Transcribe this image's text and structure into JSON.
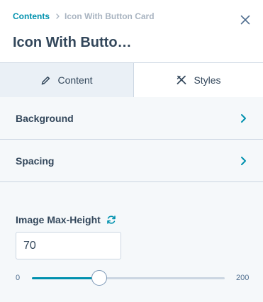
{
  "breadcrumb": {
    "parent": "Contents",
    "current": "Icon With Button Card"
  },
  "title": "Icon With Butto…",
  "tabs": {
    "content_label": "Content",
    "styles_label": "Styles",
    "active": "Content"
  },
  "sections": [
    {
      "label": "Background"
    },
    {
      "label": "Spacing"
    }
  ],
  "image_max_height": {
    "label": "Image Max-Height",
    "value": "70",
    "min_label": "0",
    "max_label": "200",
    "min": 0,
    "max": 200,
    "current": 70
  },
  "colors": {
    "accent": "#0091ae",
    "text": "#33475b",
    "muted": "#a9b4c1",
    "border": "#cbd6e2",
    "tab_active_bg": "#eaf0f6"
  },
  "icons": {
    "close": "close-icon",
    "crumb_separator": "chevron-right-icon",
    "content_tab": "pencil-icon",
    "styles_tab": "brush-ruler-icon",
    "section_chevron": "chevron-right-icon",
    "reset": "refresh-icon"
  }
}
